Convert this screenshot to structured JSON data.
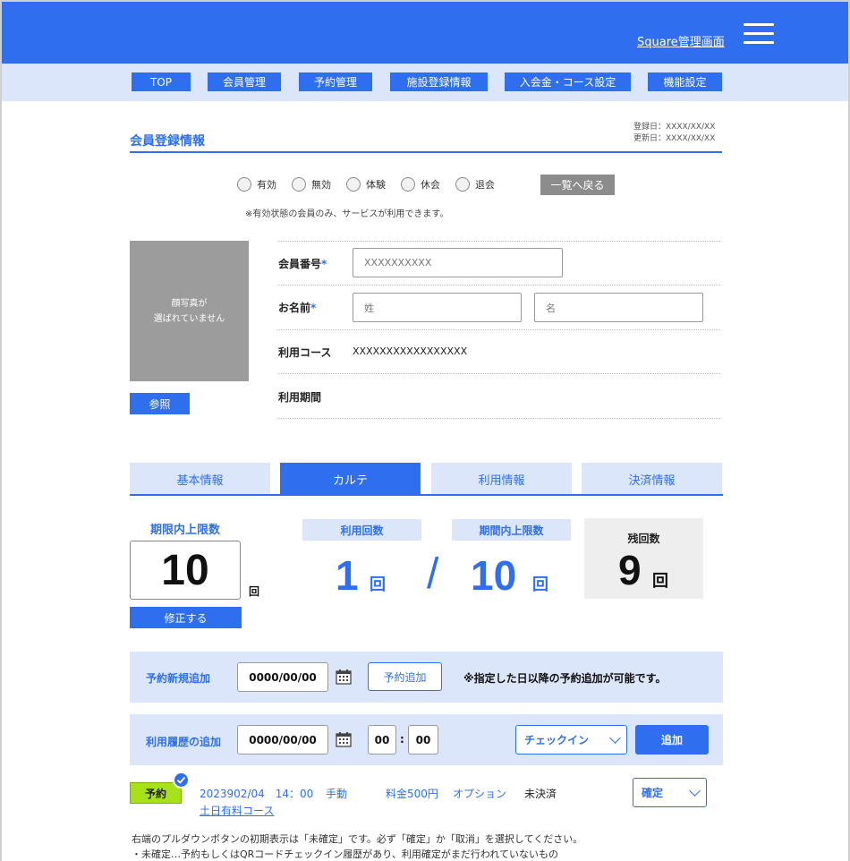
{
  "header": {
    "admin_link": "Square管理画面"
  },
  "nav": [
    "TOP",
    "会員管理",
    "予約管理",
    "施設登録情報",
    "入会金・コース設定",
    "機能設定"
  ],
  "section": {
    "title": "会員登録情報",
    "registered": "登録日：XXXX/XX/XX",
    "updated": "更新日：XXXX/XX/XX"
  },
  "status": {
    "options": [
      "有効",
      "無効",
      "体験",
      "休会",
      "退会"
    ],
    "back_button": "一覧へ戻る",
    "notice": "※有効状態の会員のみ、サービスが利用できます。"
  },
  "photo": {
    "placeholder_line1": "顔写真が",
    "placeholder_line2": "選ばれていません",
    "browse_button": "参照"
  },
  "form": {
    "member_no_label": "会員番号",
    "member_no_placeholder": "XXXXXXXXXX",
    "name_label": "お名前",
    "last_name_placeholder": "姓",
    "first_name_placeholder": "名",
    "course_label": "利用コース",
    "course_value": "XXXXXXXXXXXXXXXXX",
    "period_label": "利用期間",
    "required_mark": "*"
  },
  "tabs": [
    "基本情報",
    "カルテ",
    "利用情報",
    "決済情報"
  ],
  "active_tab": "カルテ",
  "counts": {
    "limit_label": "期限内上限数",
    "limit_value": "10",
    "unit": "回",
    "edit_button": "修正する",
    "used_label": "利用回数",
    "used_value": "1",
    "slash": "/",
    "period_limit_label": "期間内上限数",
    "period_limit_value": "10",
    "remaining_label": "残回数",
    "remaining_value": "9"
  },
  "reserve_panel": {
    "label": "予約新規追加",
    "date": "0000/00/00",
    "add_button": "予約追加",
    "note": "※指定した日以降の予約追加が可能です。"
  },
  "history_panel": {
    "label": "利用履歴の追加",
    "date": "0000/00/00",
    "hour": "00",
    "colon": ":",
    "minute": "00",
    "method": "チェックイン",
    "add_button": "追加"
  },
  "reservation": {
    "badge": "予約",
    "datetime": "2023902/04　14：00",
    "method": "手動",
    "fee": "料金500円",
    "option": "オプション",
    "payment": "未決済",
    "course": "土日有料コース",
    "status_select": "確定"
  },
  "footnotes": [
    "右端のプルダウンボタンの初期表示は「未確定」です。必ず「確定」か「取消」を選択してください。",
    "・未確定…予約もしくはQRコードチェックイン履歴があり、利用確定がまだ行われていないもの"
  ],
  "colors": {
    "primary": "#2f6fef",
    "light": "#dce6fb",
    "badge": "#a6e11a"
  }
}
